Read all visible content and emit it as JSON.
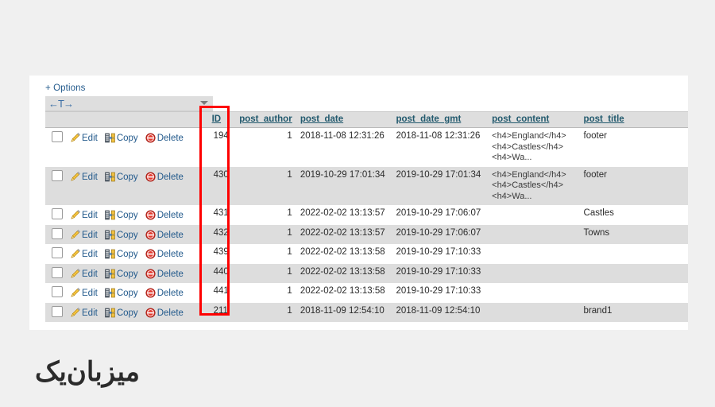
{
  "toolbar": {
    "options_label": "+ Options",
    "orientation_glyph": "←T→",
    "caret_icon": "chevron-down-icon"
  },
  "table": {
    "columns": [
      {
        "key": "actions",
        "label": ""
      },
      {
        "key": "ID",
        "label": "ID"
      },
      {
        "key": "post_author",
        "label": "post_author"
      },
      {
        "key": "post_date",
        "label": "post_date"
      },
      {
        "key": "post_date_gmt",
        "label": "post_date_gmt"
      },
      {
        "key": "post_content",
        "label": "post_content"
      },
      {
        "key": "post_title",
        "label": "post_title"
      }
    ],
    "actions": {
      "edit_label": "Edit",
      "copy_label": "Copy",
      "delete_label": "Delete",
      "edit_icon": "pencil-icon",
      "copy_icon": "copy-icon",
      "delete_icon": "delete-circle-icon",
      "checkbox_icon": "row-checkbox"
    },
    "rows": [
      {
        "ID": "194",
        "post_author": "1",
        "post_date": "2018-11-08 12:31:26",
        "post_date_gmt": "2018-11-08 12:31:26",
        "post_content_lines": [
          "<h4>England</h4>",
          "<h4>Castles</h4>",
          "<h4>Wa..."
        ],
        "post_title": "footer"
      },
      {
        "ID": "430",
        "post_author": "1",
        "post_date": "2019-10-29 17:01:34",
        "post_date_gmt": "2019-10-29 17:01:34",
        "post_content_lines": [
          "<h4>England</h4>",
          "<h4>Castles</h4>",
          "<h4>Wa..."
        ],
        "post_title": "footer"
      },
      {
        "ID": "431",
        "post_author": "1",
        "post_date": "2022-02-02 13:13:57",
        "post_date_gmt": "2019-10-29 17:06:07",
        "post_content_lines": [],
        "post_title": "Castles"
      },
      {
        "ID": "432",
        "post_author": "1",
        "post_date": "2022-02-02 13:13:57",
        "post_date_gmt": "2019-10-29 17:06:07",
        "post_content_lines": [],
        "post_title": "Towns"
      },
      {
        "ID": "439",
        "post_author": "1",
        "post_date": "2022-02-02 13:13:58",
        "post_date_gmt": "2019-10-29 17:10:33",
        "post_content_lines": [],
        "post_title": ""
      },
      {
        "ID": "440",
        "post_author": "1",
        "post_date": "2022-02-02 13:13:58",
        "post_date_gmt": "2019-10-29 17:10:33",
        "post_content_lines": [],
        "post_title": ""
      },
      {
        "ID": "441",
        "post_author": "1",
        "post_date": "2022-02-02 13:13:58",
        "post_date_gmt": "2019-10-29 17:10:33",
        "post_content_lines": [],
        "post_title": ""
      },
      {
        "ID": "211",
        "post_author": "1",
        "post_date": "2018-11-09 12:54:10",
        "post_date_gmt": "2018-11-09 12:54:10",
        "post_content_lines": [],
        "post_title": "brand1"
      }
    ]
  },
  "annotation": {
    "highlight_column": "ID",
    "highlight_color": "#fe0000"
  },
  "branding": {
    "logo_text": "میزبان‌یک"
  },
  "colors": {
    "page_background": "#f0f0f0",
    "card_background": "#ffffff",
    "header_background": "#dedede",
    "row_alt_background": "#dddddd",
    "link_color": "#235a8c",
    "column_header_color": "#235a6e"
  }
}
